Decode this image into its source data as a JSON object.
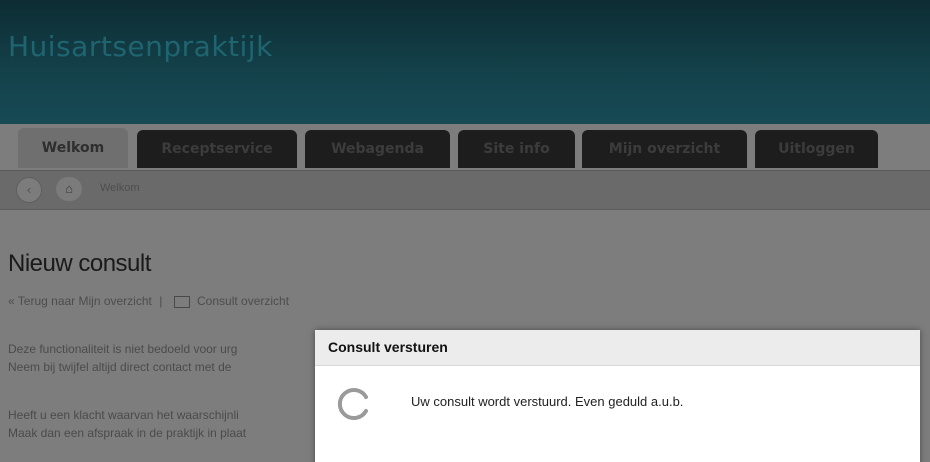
{
  "header": {
    "brand": "Huisartsenpraktijk"
  },
  "tabs": [
    {
      "label": "Welkom"
    },
    {
      "label": "Receptservice"
    },
    {
      "label": "Webagenda"
    },
    {
      "label": "Site info"
    },
    {
      "label": "Mijn overzicht"
    },
    {
      "label": "Uitloggen"
    }
  ],
  "breadcrumb": {
    "current": "Welkom"
  },
  "page": {
    "title": "Nieuw consult",
    "back_link": "« Terug naar Mijn overzicht",
    "separator": "|",
    "overview_link": "Consult overzicht",
    "para1_line1": "Deze functionaliteit is niet bedoeld voor urg",
    "para1_line2": "Neem bij twijfel altijd direct contact met de",
    "para2_line1": "Heeft u een klacht waarvan het waarschijnli",
    "para2_line2": "Maak dan een afspraak in de praktijk in plaat"
  },
  "modal": {
    "title": "Consult versturen",
    "message": "Uw consult wordt verstuurd. Even geduld a.u.b."
  }
}
